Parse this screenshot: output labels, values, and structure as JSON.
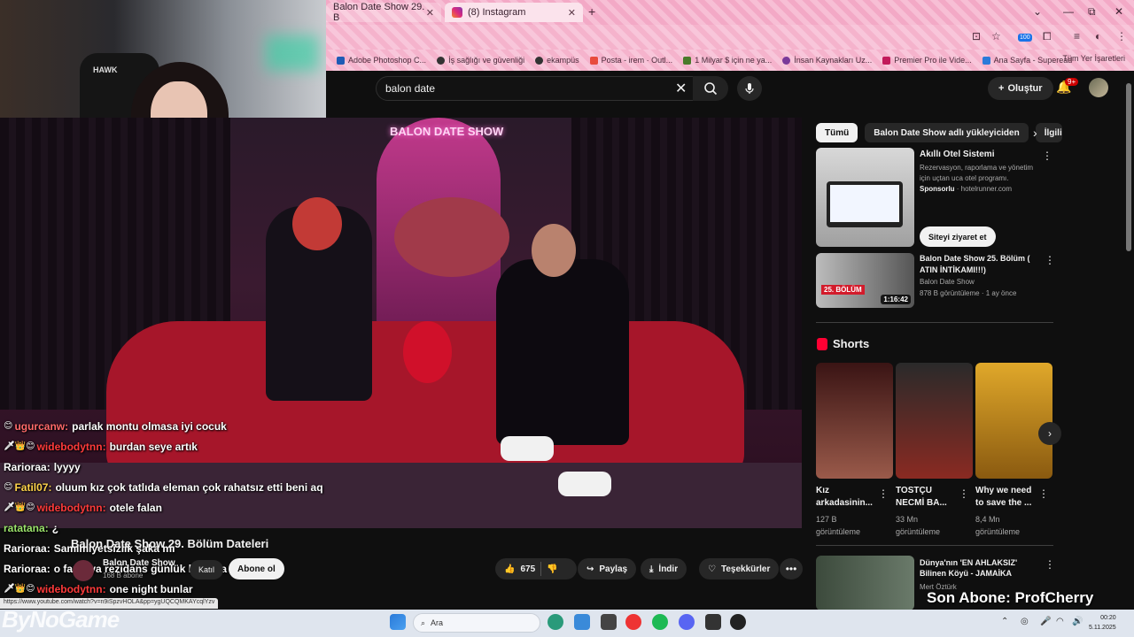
{
  "browser": {
    "tabs": [
      {
        "label": "Balon Date Show 29. B"
      },
      {
        "label": "(8) Instagram"
      }
    ],
    "new_tab": "+",
    "window_controls": [
      "⌄",
      "—",
      "⧉",
      "✕"
    ],
    "extension_badge": "100",
    "bookmarks": [
      "Adobe Photoshop C...",
      "İş sağlığı ve güvenliği",
      "ekampüs",
      "Posta - irem · Outl...",
      "1 Milyar $ için ne ya...",
      "İnsan Kaynakları Uz...",
      "Premier Pro ile Vide...",
      "Ana Sayfa - Superead"
    ],
    "bookmarks_right": "Tüm Yer İşaretleri",
    "status_url": "https://www.youtube.com/watch?v=n9iSpzvHOLA&pp=ygUQCQMKAYcqlYzv"
  },
  "youtube": {
    "search_value": "balon date",
    "create_label": "Oluştur",
    "notification_count": "9+",
    "video": {
      "neon_sign": "BALON DATE SHOW",
      "title": "Balon Date Show 29. Bölüm Dateleri",
      "channel": "Balon Date Show",
      "subscribers": "168 B abone",
      "join_label": "Katıl",
      "subscribe_label": "Abone ol",
      "likes": "675",
      "share_label": "Paylaş",
      "download_label": "İndir",
      "thanks_label": "Teşekkürler",
      "more": "•••"
    },
    "chips": [
      "Tümü",
      "Balon Date Show adlı yükleyiciden",
      "İlgili"
    ],
    "ad": {
      "title": "Akıllı Otel Sistemi",
      "description": "Rezervasyon, raporlama ve yönetim için uçtan uca otel programı.",
      "sponsored": "Sponsorlu",
      "domain": "hotelrunner.com",
      "cta": "Siteyi ziyaret et"
    },
    "rec1": {
      "title": "Balon Date Show 25. Bölüm ( ATIN İNTİKAMI!!!)",
      "channel": "Balon Date Show",
      "meta": "878 B görüntüleme · 1 ay önce",
      "duration": "1:16:42",
      "tag": "25. BÖLÜM"
    },
    "shorts_heading": "Shorts",
    "shorts": [
      {
        "title": "Kız arkadasinin...",
        "views": "127 B görüntüleme",
        "color": "#6b2a2a"
      },
      {
        "title": "TOSTÇU NECMİ BA...",
        "views": "33 Mn görüntüleme",
        "color": "#7a2a22"
      },
      {
        "title": "Why we need to save the ...",
        "views": "8,4 Mn görüntüleme",
        "color": "#d9a020"
      }
    ],
    "rec2": {
      "title": "Dünya'nın 'EN AHLAKSIZ' Bilinen Köyü - JAMAİKA",
      "channel": "Mert Öztürk"
    }
  },
  "chat": [
    {
      "badges": "😊",
      "user": "ugurcanw:",
      "color": "#ff6a6a",
      "message": "parlak montu olmasa iyi cocuk"
    },
    {
      "badges": "🗡👑😊",
      "user": "widebodytnn:",
      "color": "#ff3b3b",
      "message": "burdan seye artık"
    },
    {
      "badges": "",
      "user": "Rarioraa:",
      "color": "#ffffff",
      "message": "lyyyy"
    },
    {
      "badges": "😊",
      "user": "Fatil07:",
      "color": "#ffd34a",
      "message": "oluum kız çok tatlıda eleman çok rahatsız etti beni aq"
    },
    {
      "badges": "🗡👑😊",
      "user": "widebodytnn:",
      "color": "#ff3b3b",
      "message": "otele falan"
    },
    {
      "badges": "",
      "user": "ratatana:",
      "color": "#9be36b",
      "message": "¿"
    },
    {
      "badges": "",
      "user": "Rarioraa:",
      "color": "#ffffff",
      "message": "Samimiyetsizlik şaka mı"
    },
    {
      "badges": "",
      "user": "Rarioraa:",
      "color": "#ffffff",
      "message": "o fazla ya rezidans günlük bunlara ideal"
    },
    {
      "badges": "🗡👑😊",
      "user": "widebodytnn:",
      "color": "#ff3b3b",
      "message": "one night bunlar"
    }
  ],
  "overlay": {
    "last_sub": "Son Abone: ProfCherry",
    "watermark": "ByNoGame"
  },
  "taskbar": {
    "search_placeholder": "Ara",
    "time": "00:20",
    "date": "5.11.2025",
    "tray_lang": "🔊"
  }
}
